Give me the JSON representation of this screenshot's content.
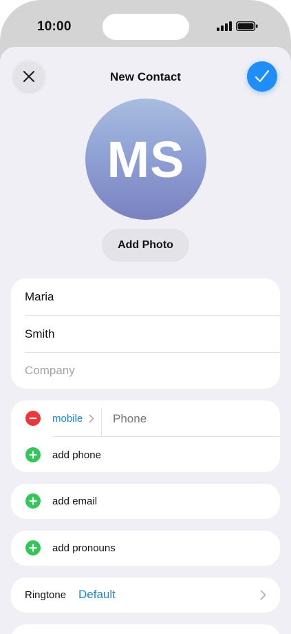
{
  "status_bar": {
    "time": "10:00"
  },
  "nav": {
    "title": "New Contact",
    "close_icon": "close-icon",
    "done_icon": "checkmark-icon"
  },
  "avatar": {
    "initials": "MS",
    "add_photo_label": "Add Photo"
  },
  "name_fields": {
    "first_name": "Maria",
    "last_name": "Smith",
    "company_placeholder": "Company"
  },
  "phone_section": {
    "label": "mobile",
    "phone_placeholder": "Phone",
    "add_phone_label": "add phone"
  },
  "email_section": {
    "add_email_label": "add email"
  },
  "pronouns_section": {
    "add_pronouns_label": "add pronouns"
  },
  "ringtone_section": {
    "label": "Ringtone",
    "value": "Default"
  },
  "colors": {
    "accent": "#1f8efa",
    "link": "#1a86e0",
    "delete": "#f0353a",
    "add": "#33c659",
    "background": "#f0eff5"
  }
}
